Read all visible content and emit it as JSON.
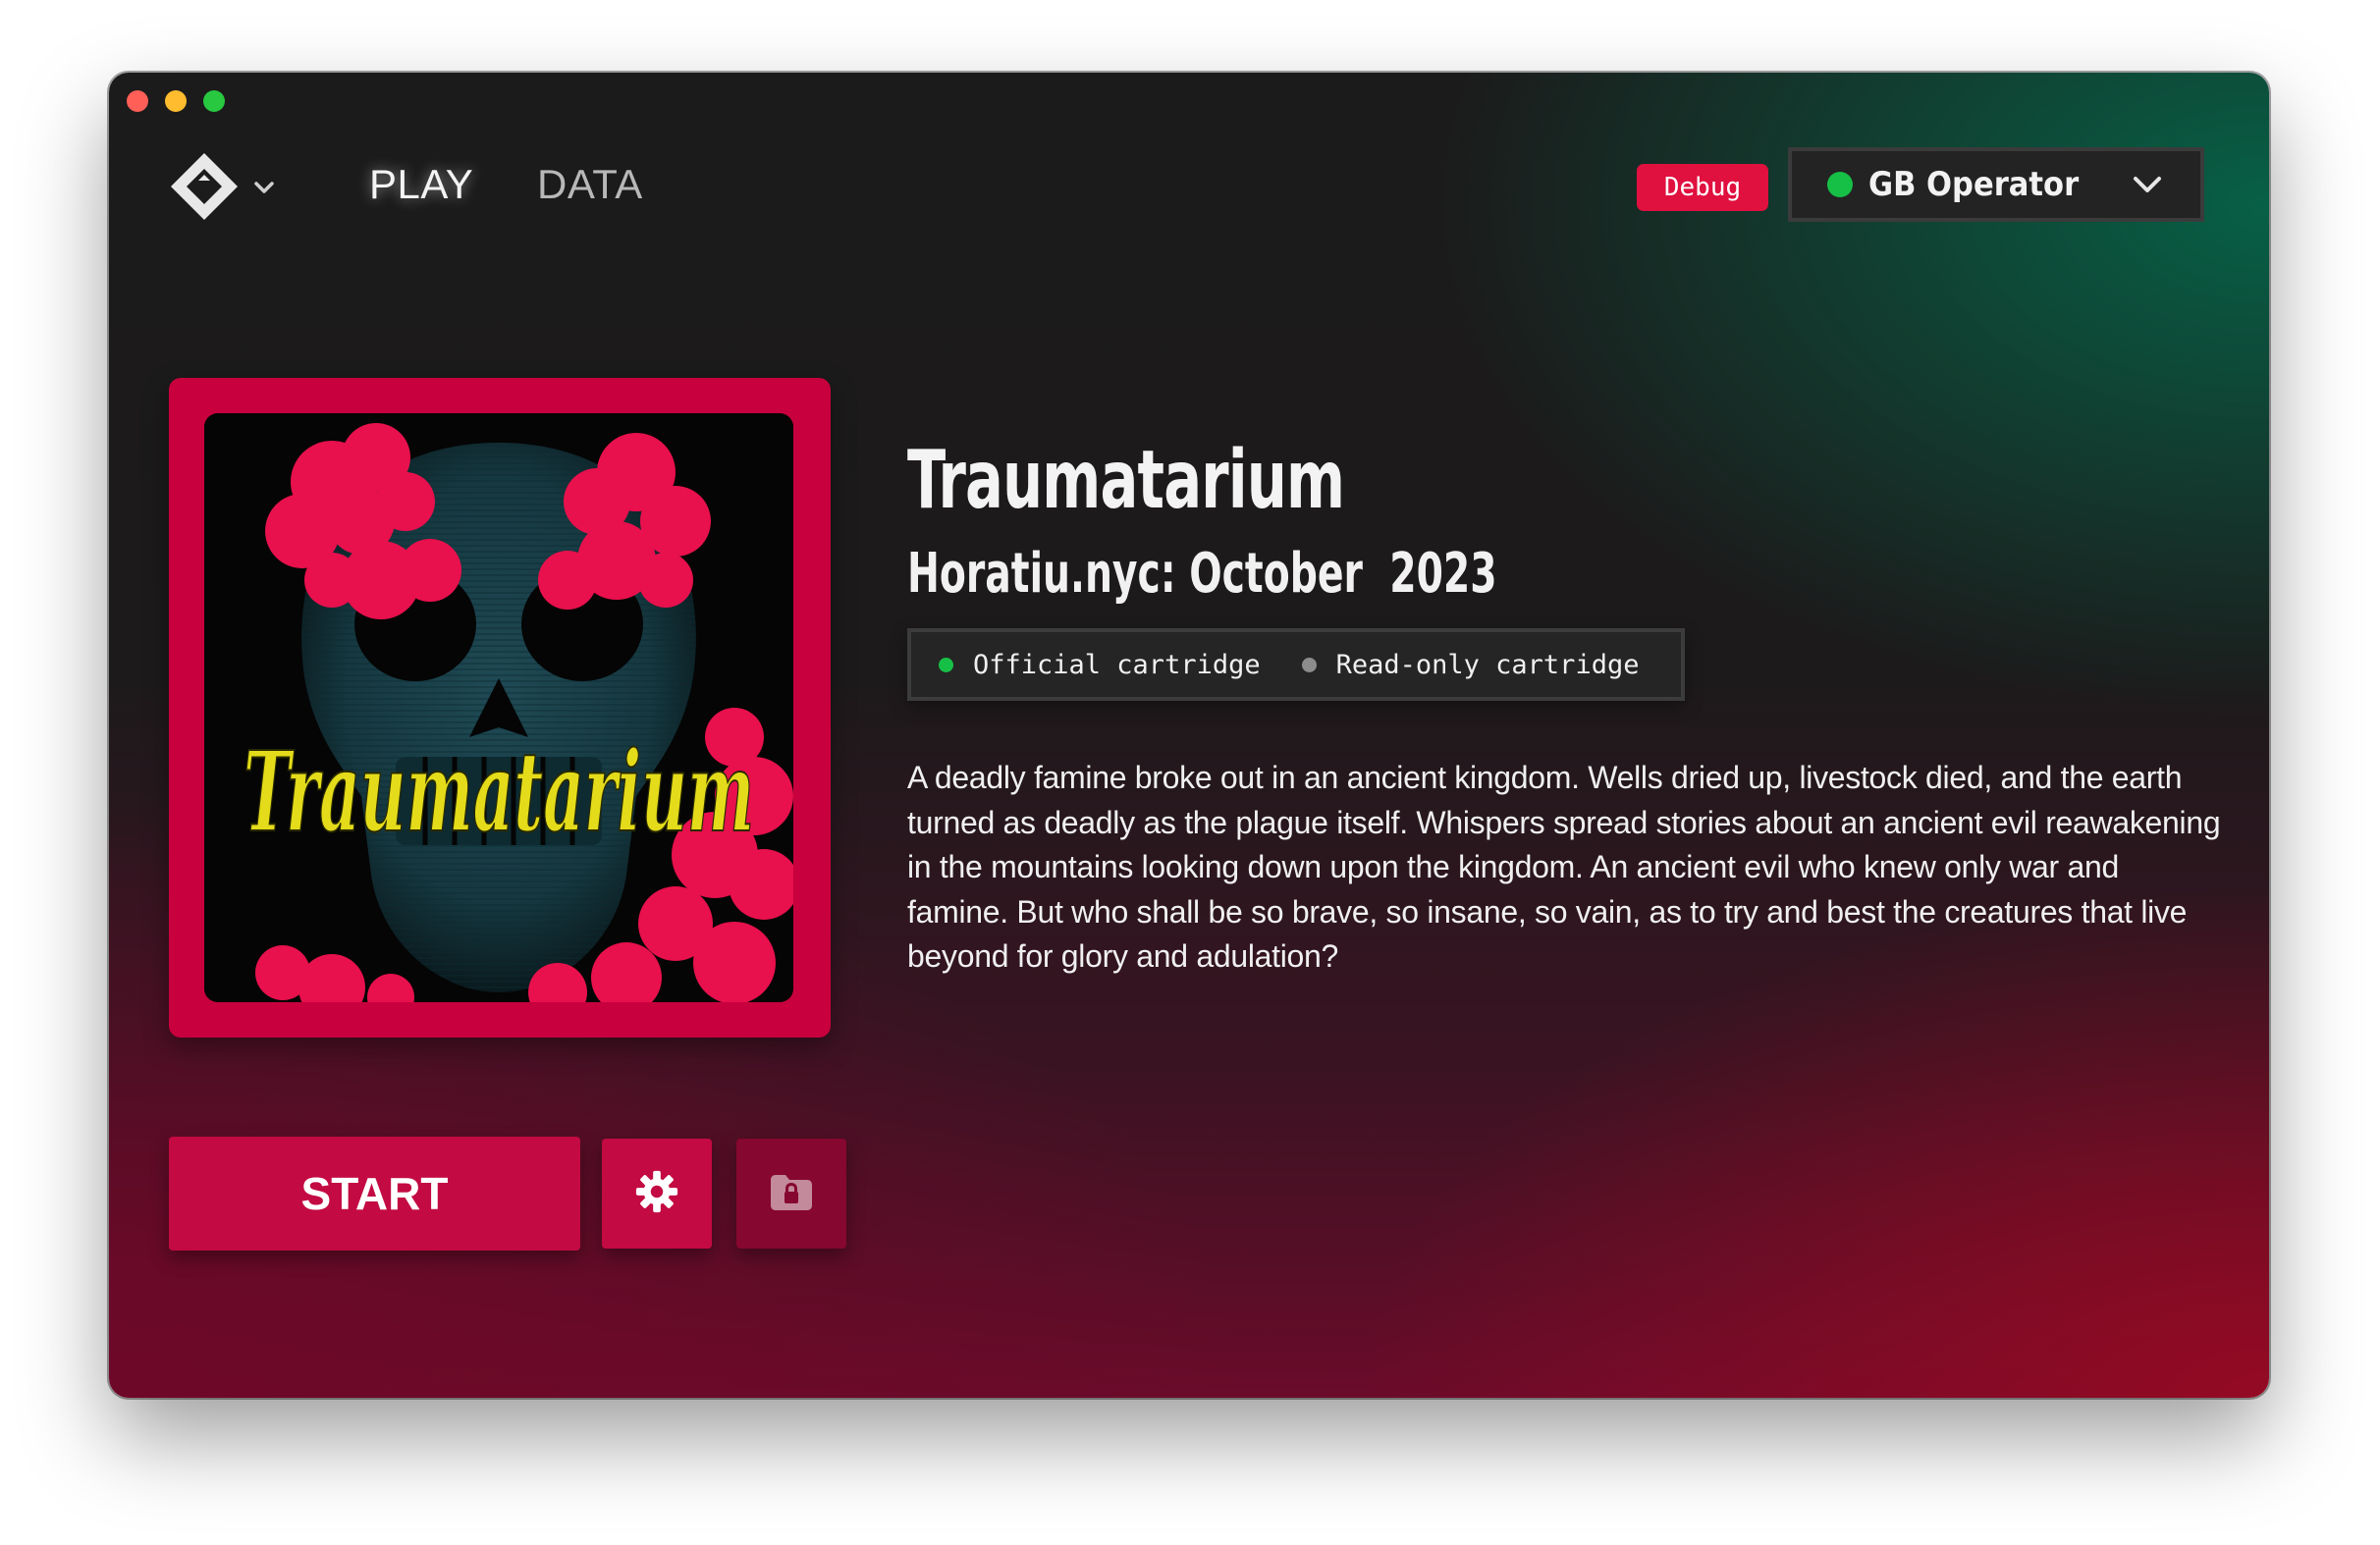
{
  "window": {
    "traffic_lights": [
      "close",
      "minimize",
      "zoom"
    ]
  },
  "header": {
    "logo_icon": "app-logo-icon",
    "logo_menu_icon": "chevron-down-icon",
    "nav": [
      {
        "label": "PLAY",
        "active": true
      },
      {
        "label": "DATA",
        "active": false
      }
    ],
    "debug_label": "Debug",
    "device_selector": {
      "label": "GB Operator",
      "status": "connected",
      "status_color": "#16c046",
      "icon": "chevron-down-icon"
    }
  },
  "game": {
    "cover_title_art": "Traumatarium",
    "title": "Traumatarium",
    "subtitle": "Horatiu.nyc: October  2023",
    "tags": [
      {
        "label": "Official cartridge",
        "dot_color": "#16c046"
      },
      {
        "label": "Read-only cartridge",
        "dot_color": "#8c8c8c"
      }
    ],
    "description": "A deadly famine broke out in an ancient kingdom. Wells dried up, livestock died, and the earth turned as deadly as the plague itself. Whispers spread stories about an ancient evil reawakening in the mountains looking down upon the kingdom. An ancient evil who knew only war and famine. But who shall be so brave, so insane, so vain, as to try and best the creatures that live beyond for glory and adulation?"
  },
  "actions": {
    "start_label": "START",
    "settings_icon": "gear-icon",
    "locked_folder_icon": "folder-lock-icon"
  },
  "colors": {
    "accent": "#c30a43",
    "debug_badge": "#e0103f",
    "connected": "#16c046"
  }
}
